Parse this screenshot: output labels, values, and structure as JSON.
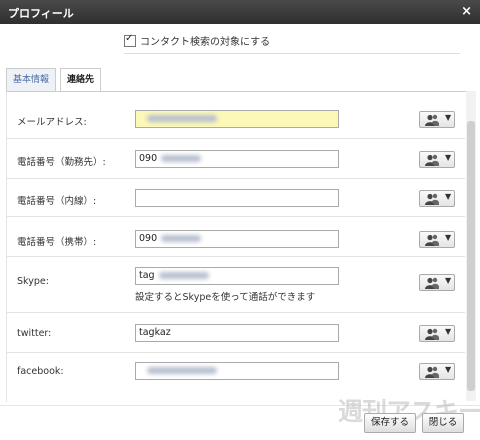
{
  "dialog": {
    "title": "プロフィール",
    "close_glyph": "×"
  },
  "search_toggle": {
    "label": "コンタクト検索の対象にする",
    "checked": true
  },
  "tabs": [
    {
      "label": "基本情報",
      "active": false
    },
    {
      "label": "連絡先",
      "active": true
    }
  ],
  "fields": [
    {
      "label": "メールアドレス:",
      "value": "",
      "highlighted": true
    },
    {
      "label": "電話番号（勤務先）:",
      "value": "090"
    },
    {
      "label": "電話番号（内線）:",
      "value": ""
    },
    {
      "label": "電話番号（携帯）:",
      "value": "090"
    },
    {
      "label": "Skype:",
      "value": "tag",
      "helper": "設定するとSkypeを使って通話ができます"
    },
    {
      "label": "twitter:",
      "value": "tagkaz"
    },
    {
      "label": "facebook:",
      "value": ""
    }
  ],
  "visibility_control": {
    "icon": "people-icon",
    "caret": "▼"
  },
  "buttons": {
    "save": "保存する",
    "close": "閉じる"
  },
  "watermark": "週刊アスキー",
  "colors": {
    "titlebar": "#333333",
    "highlight_field": "#fbf8b8",
    "tab_link": "#4b6aa3"
  }
}
